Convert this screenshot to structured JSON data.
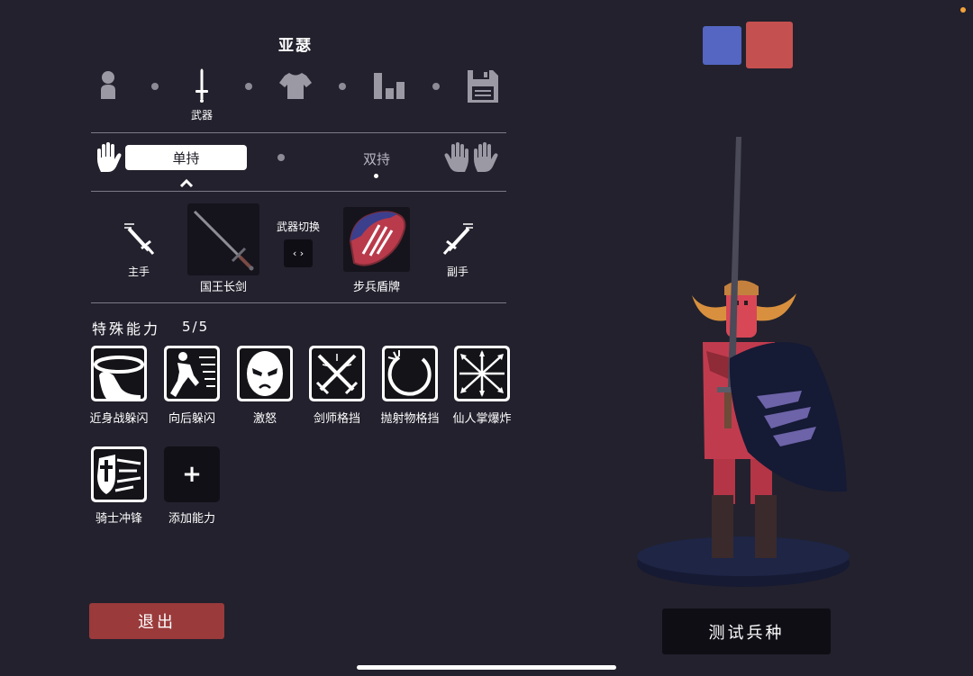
{
  "unit": {
    "name": "亚瑟"
  },
  "tabs": {
    "active_label": "武器"
  },
  "grip": {
    "one_handed": "单持",
    "two_handed": "双持"
  },
  "weapons": {
    "main_hand_label": "主手",
    "main_weapon_name": "国王长剑",
    "swap_label": "武器切换",
    "swap_icon": "‹ ›",
    "off_weapon_name": "步兵盾牌",
    "off_hand_label": "副手"
  },
  "abilities": {
    "title": "特殊能力",
    "count": "5/5",
    "items": [
      {
        "label": "近身战躲闪",
        "icon": "melee-dodge-icon"
      },
      {
        "label": "向后躲闪",
        "icon": "backstep-icon"
      },
      {
        "label": "激怒",
        "icon": "taunt-face-icon"
      },
      {
        "label": "剑师格挡",
        "icon": "sword-block-icon"
      },
      {
        "label": "抛射物格挡",
        "icon": "projectile-block-icon"
      },
      {
        "label": "仙人掌爆炸",
        "icon": "cactus-explosion-icon"
      },
      {
        "label": "骑士冲锋",
        "icon": "knight-charge-icon"
      }
    ],
    "add_label": "添加能力",
    "add_symbol": "+"
  },
  "buttons": {
    "exit": "退出",
    "test": "测试兵种"
  },
  "colors": {
    "team_blue": "#5466c1",
    "team_red": "#c55050",
    "exit": "#9a3a3b",
    "background": "#23212d"
  }
}
